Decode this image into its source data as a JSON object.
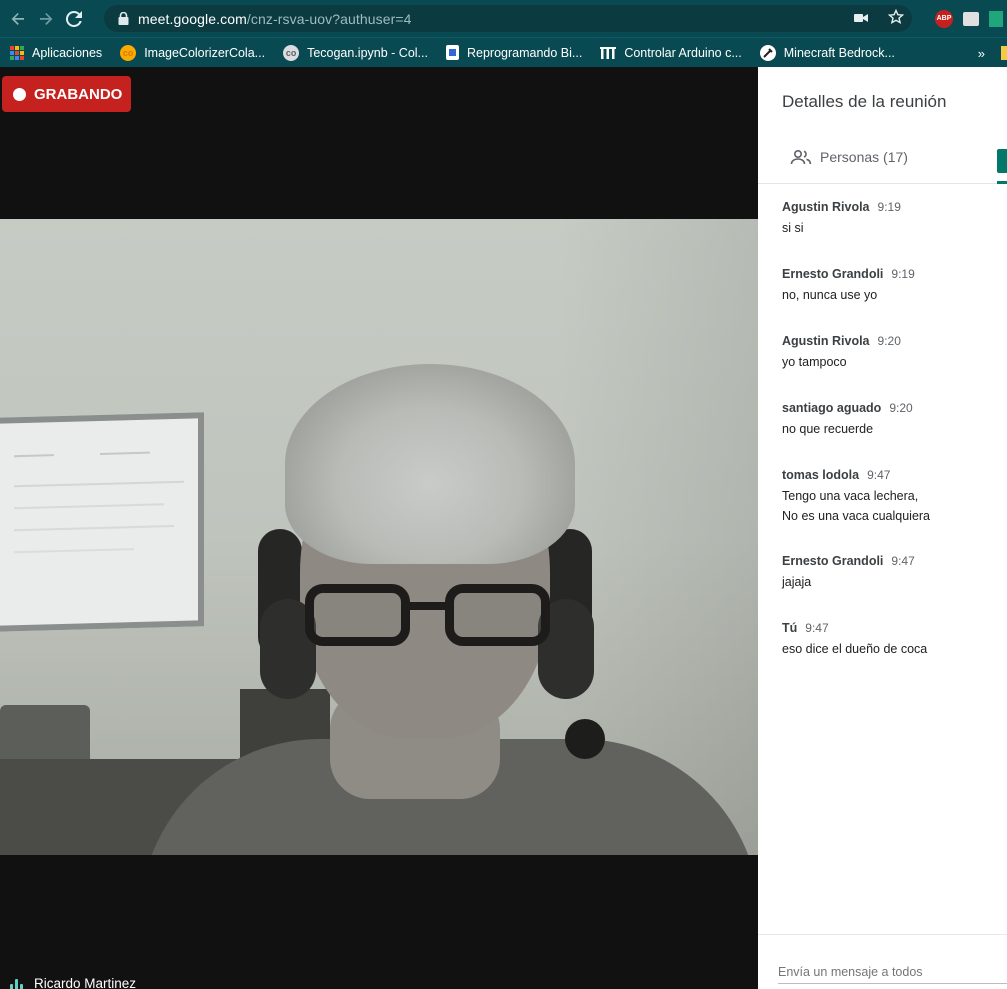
{
  "browser": {
    "url_host": "meet.google.com",
    "url_path": "/cnz-rsva-uov?authuser=4",
    "bookmarks": [
      {
        "label": "Aplicaciones",
        "icon": "apps-grid-icon"
      },
      {
        "label": "ImageColorizerCola...",
        "icon": "colab-icon"
      },
      {
        "label": "Tecogan.ipynb - Col...",
        "icon": "colab-icon"
      },
      {
        "label": "Reprogramando Bi...",
        "icon": "page-icon"
      },
      {
        "label": "Controlar Arduino c...",
        "icon": "lll-icon"
      },
      {
        "label": "Minecraft Bedrock...",
        "icon": "minecraft-icon"
      }
    ],
    "more_bookmarks": "»",
    "extensions": [
      "camera-icon",
      "star-icon",
      "abp-icon",
      "extension-icon",
      "extension-icon"
    ],
    "abp_label": "ABP"
  },
  "meeting": {
    "recording_label": "GRABANDO",
    "participant_name": "Ricardo Martinez"
  },
  "panel": {
    "title": "Detalles de la reunión",
    "people_tab": "Personas (17)",
    "messages": [
      {
        "sender": "Agustin Rivola",
        "time": "9:19",
        "lines": [
          "si si"
        ]
      },
      {
        "sender": "Ernesto Grandoli",
        "time": "9:19",
        "lines": [
          "no, nunca use yo"
        ]
      },
      {
        "sender": "Agustin Rivola",
        "time": "9:20",
        "lines": [
          "yo tampoco"
        ]
      },
      {
        "sender": "santiago aguado",
        "time": "9:20",
        "lines": [
          "no que recuerde"
        ]
      },
      {
        "sender": "tomas lodola",
        "time": "9:47",
        "lines": [
          "Tengo una vaca lechera,",
          "No es una vaca cualquiera"
        ]
      },
      {
        "sender": "Ernesto Grandoli",
        "time": "9:47",
        "lines": [
          "jajaja"
        ]
      },
      {
        "sender": "Tú",
        "time": "9:47",
        "lines": [
          "eso dice el dueño de coca"
        ]
      }
    ],
    "compose_placeholder": "Envía un mensaje a todos"
  },
  "colors": {
    "chrome_bg": "#094a52",
    "recording_red": "#c5221f",
    "meet_teal": "#00796b"
  }
}
